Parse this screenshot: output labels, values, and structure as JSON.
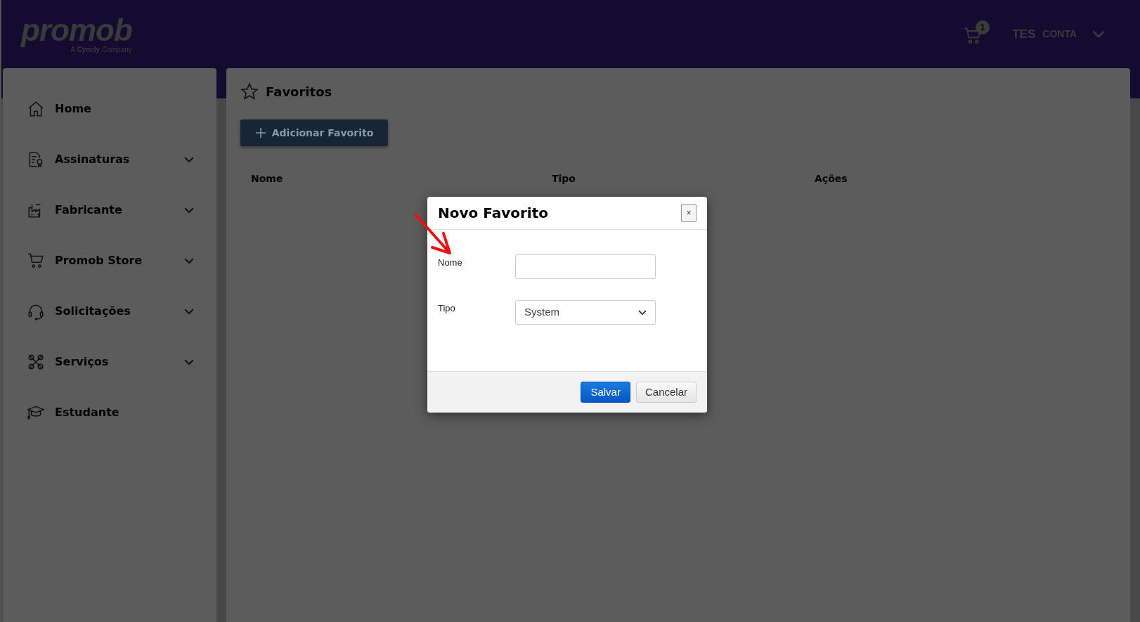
{
  "header": {
    "logo": {
      "name": "promob",
      "tagline_prefix": "A",
      "tagline_brand": "Cyncly",
      "tagline_suffix": "Company"
    },
    "cart_count": "1",
    "account": {
      "initials": "TES",
      "label": "CONTA"
    }
  },
  "sidebar": {
    "items": [
      {
        "label": "Home",
        "kind": "link"
      },
      {
        "label": "Assinaturas",
        "kind": "group"
      },
      {
        "label": "Fabricante",
        "kind": "group"
      },
      {
        "label": "Promob Store",
        "kind": "group"
      },
      {
        "label": "Solicitações",
        "kind": "group"
      },
      {
        "label": "Serviços",
        "kind": "group"
      },
      {
        "label": "Estudante",
        "kind": "link"
      }
    ]
  },
  "page": {
    "title": "Favoritos",
    "add_button": "Adicionar Favorito",
    "table": {
      "columns": [
        "Nome",
        "Tipo",
        "Ações"
      ]
    }
  },
  "modal": {
    "title": "Novo Favorito",
    "close": "×",
    "fields": [
      {
        "label": "Nome",
        "kind": "text"
      },
      {
        "label": "Tipo",
        "kind": "select",
        "value": "System"
      }
    ],
    "buttons": [
      {
        "label": "Salvar",
        "kind": "primary"
      },
      {
        "label": "Cancelar",
        "kind": "secondary"
      }
    ]
  }
}
